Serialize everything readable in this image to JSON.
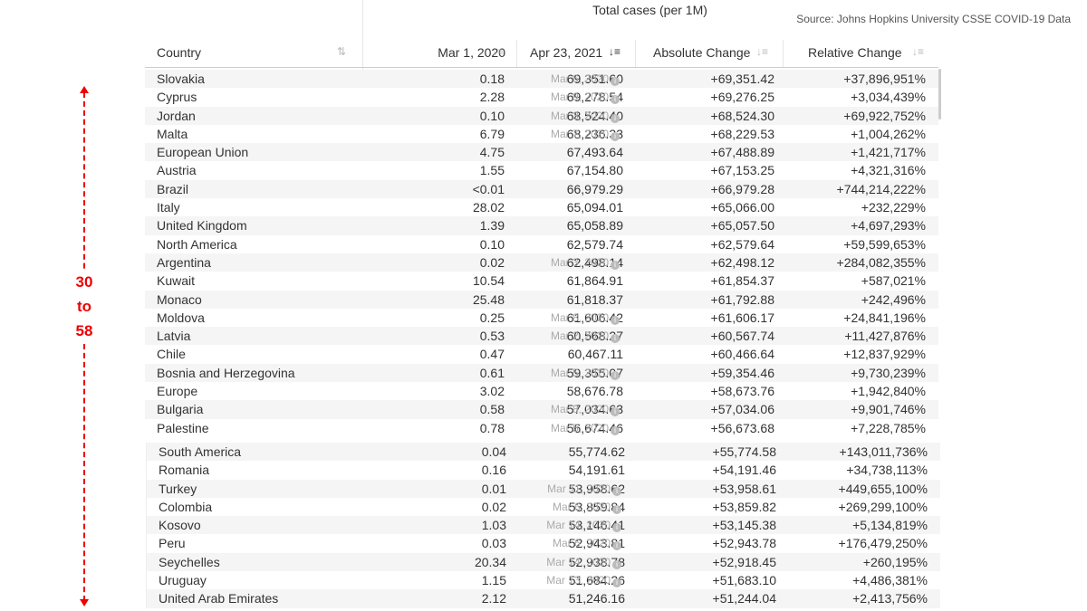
{
  "title": "Total cases (per 1M)",
  "source": "Source: Johns Hopkins University CSSE COVID-19 Data",
  "columns": {
    "country": "Country",
    "mar": "Mar 1, 2020",
    "apr": "Apr 23, 2021",
    "abs": "Absolute Change",
    "rel": "Relative Change"
  },
  "sort_column": "Apr 23, 2021",
  "annotation": {
    "from": "30",
    "to_word": "to",
    "to": "58",
    "color": "#e00000"
  },
  "rows_top": [
    [
      "Slovakia",
      "Mar 6, 2020",
      "0.18",
      "69,351.60",
      "+69,351.42",
      "+37,896,951%"
    ],
    [
      "Cyprus",
      "Mar 9, 2020",
      "2.28",
      "69,278.54",
      "+69,276.25",
      "+3,034,439%"
    ],
    [
      "Jordan",
      "Mar 3, 2020",
      "0.10",
      "68,524.40",
      "+68,524.30",
      "+69,922,752%"
    ],
    [
      "Malta",
      "Mar 7, 2020",
      "6.79",
      "68,236.33",
      "+68,229.53",
      "+1,004,262%"
    ],
    [
      "European Union",
      "",
      "4.75",
      "67,493.64",
      "+67,488.89",
      "+1,421,717%"
    ],
    [
      "Austria",
      "",
      "1.55",
      "67,154.80",
      "+67,153.25",
      "+4,321,316%"
    ],
    [
      "Brazil",
      "",
      "<0.01",
      "66,979.29",
      "+66,979.28",
      "+744,214,222%"
    ],
    [
      "Italy",
      "",
      "28.02",
      "65,094.01",
      "+65,066.00",
      "+232,229%"
    ],
    [
      "United Kingdom",
      "",
      "1.39",
      "65,058.89",
      "+65,057.50",
      "+4,697,293%"
    ],
    [
      "North America",
      "",
      "0.10",
      "62,579.74",
      "+62,579.64",
      "+59,599,653%"
    ],
    [
      "Argentina",
      "Mar 3, 2020",
      "0.02",
      "62,498.14",
      "+62,498.12",
      "+284,082,355%"
    ],
    [
      "Kuwait",
      "",
      "10.54",
      "61,864.91",
      "+61,854.37",
      "+587,021%"
    ],
    [
      "Monaco",
      "",
      "25.48",
      "61,818.37",
      "+61,792.88",
      "+242,496%"
    ],
    [
      "Moldova",
      "Mar 8, 2020",
      "0.25",
      "61,606.42",
      "+61,606.17",
      "+24,841,196%"
    ],
    [
      "Latvia",
      "Mar 2, 2020",
      "0.53",
      "60,568.27",
      "+60,567.74",
      "+11,427,876%"
    ],
    [
      "Chile",
      "",
      "0.47",
      "60,467.11",
      "+60,466.64",
      "+12,837,929%"
    ],
    [
      "Bosnia and Herzegovina",
      "Mar 5, 2020",
      "0.61",
      "59,355.07",
      "+59,354.46",
      "+9,730,239%"
    ],
    [
      "Europe",
      "",
      "3.02",
      "58,676.78",
      "+58,673.76",
      "+1,942,840%"
    ],
    [
      "Bulgaria",
      "Mar 8, 2020",
      "0.58",
      "57,034.63",
      "+57,034.06",
      "+9,901,746%"
    ],
    [
      "Palestine",
      "Mar 5, 2020",
      "0.78",
      "56,674.46",
      "+56,673.68",
      "+7,228,785%"
    ]
  ],
  "rows_bottom": [
    [
      "South America",
      "",
      "0.04",
      "55,774.62",
      "+55,774.58",
      "+143,011,736%"
    ],
    [
      "Romania",
      "",
      "0.16",
      "54,191.61",
      "+54,191.46",
      "+34,738,113%"
    ],
    [
      "Turkey",
      "Mar 11, 2020",
      "0.01",
      "53,958.62",
      "+53,958.61",
      "+449,655,100%"
    ],
    [
      "Colombia",
      "Mar 6, 2020",
      "0.02",
      "53,859.84",
      "+53,859.82",
      "+269,299,100%"
    ],
    [
      "Kosovo",
      "Mar 14, 2020",
      "1.03",
      "53,146.41",
      "+53,145.38",
      "+5,134,819%"
    ],
    [
      "Peru",
      "Mar 6, 2020",
      "0.03",
      "52,943.81",
      "+52,943.78",
      "+176,479,250%"
    ],
    [
      "Seychelles",
      "Mar 14, 2020",
      "20.34",
      "52,938.78",
      "+52,918.45",
      "+260,195%"
    ],
    [
      "Uruguay",
      "Mar 13, 2020",
      "1.15",
      "51,684.26",
      "+51,683.10",
      "+4,486,381%"
    ],
    [
      "United Arab Emirates",
      "",
      "2.12",
      "51,246.16",
      "+51,244.04",
      "+2,413,756%"
    ]
  ]
}
